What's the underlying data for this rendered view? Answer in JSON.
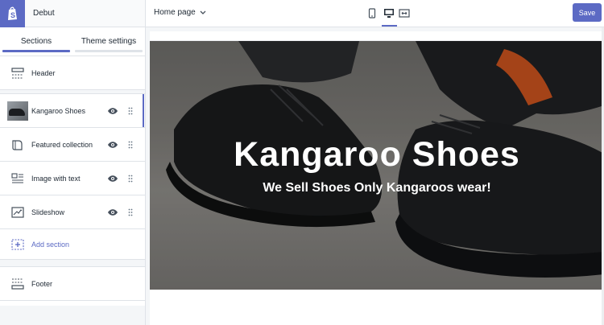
{
  "app": {
    "theme_name": "Debut"
  },
  "sidebar": {
    "tabs": [
      {
        "label": "Sections"
      },
      {
        "label": "Theme settings"
      }
    ],
    "header_row": {
      "label": "Header"
    },
    "sections": [
      {
        "label": "Kangaroo Shoes",
        "icon": "image-thumbnail",
        "selected": true
      },
      {
        "label": "Featured collection",
        "icon": "book-icon"
      },
      {
        "label": "Image with text",
        "icon": "image-text-icon"
      },
      {
        "label": "Slideshow",
        "icon": "slideshow-icon"
      }
    ],
    "add_section": {
      "label": "Add section"
    },
    "footer_row": {
      "label": "Footer"
    }
  },
  "topbar": {
    "page_select": "Home page",
    "devices": [
      "mobile-icon",
      "desktop-icon",
      "fullscreen-icon"
    ],
    "active_device": "desktop-icon",
    "save_label": "Save"
  },
  "preview": {
    "hero_title": "Kangaroo Shoes",
    "hero_subtitle": "We Sell Shoes Only Kangaroos wear!"
  },
  "colors": {
    "accent": "#5c6ac4",
    "border": "#dfe3e8",
    "background": "#f4f6f8"
  }
}
